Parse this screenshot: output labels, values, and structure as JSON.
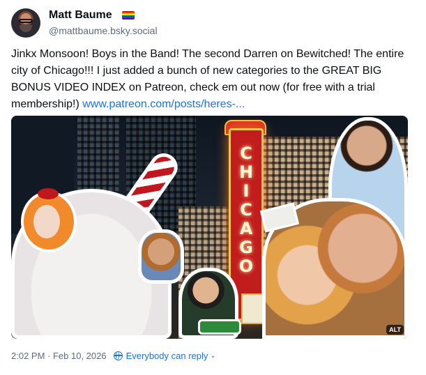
{
  "author": {
    "display_name": "Matt Baume",
    "handle": "@mattbaume.bsky.social",
    "flag_colors": [
      "#e40303",
      "#ff8c00",
      "#ffed00",
      "#008026",
      "#004dff",
      "#750787"
    ]
  },
  "post": {
    "text": "Jinkx Monsoon! Boys in the Band! The second Darren on Bewitched! The entire city of Chicago!!! I just added a bunch of new categories to the GREAT BIG BONUS VIDEO INDEX on Patreon, check em out now (for free with a trial membership!) ",
    "link_text": "www.patreon.com/posts/heres-...",
    "image": {
      "alt_badge": "ALT",
      "sign_letters": [
        "C",
        "H",
        "I",
        "C",
        "A",
        "G",
        "O"
      ]
    }
  },
  "footer": {
    "timestamp": "2:02 PM · Feb 10, 2026",
    "reply_setting": "Everybody can reply",
    "reply_icon": "globe-icon",
    "accent_color": "#1a72e8"
  }
}
